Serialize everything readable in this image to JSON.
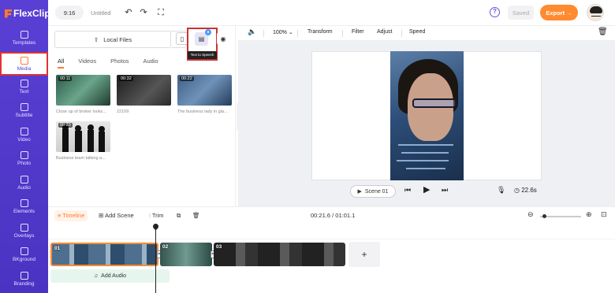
{
  "app": {
    "brand": "FlexClip",
    "project_title": "Untitled"
  },
  "topbar": {
    "ratio": "9:16",
    "saved_label": "Saved",
    "export_label": "Export →"
  },
  "sidebar": {
    "items": [
      {
        "label": "Templates"
      },
      {
        "label": "Media"
      },
      {
        "label": "Text"
      },
      {
        "label": "Subtitle"
      },
      {
        "label": "Video"
      },
      {
        "label": "Photo"
      },
      {
        "label": "Audio"
      },
      {
        "label": "Elements"
      },
      {
        "label": "Overlays"
      },
      {
        "label": "BKground"
      },
      {
        "label": "Branding"
      }
    ]
  },
  "media": {
    "local_files_label": "Local Files",
    "tooltip": "Text to Speech",
    "tabs": [
      "All",
      "Videos",
      "Photos",
      "Audio"
    ],
    "items": [
      {
        "duration": "00:11",
        "caption": "Close up of broker looks..."
      },
      {
        "duration": "00:32",
        "caption": "22109"
      },
      {
        "duration": "00:22",
        "caption": "The business lady in gla..."
      },
      {
        "duration": "00:23",
        "caption": "Business team talking a..."
      }
    ]
  },
  "preview_toolbar": {
    "zoom": "100%",
    "transform": "Transform",
    "filter": "Filter",
    "adjust": "Adjust",
    "speed": "Speed"
  },
  "player": {
    "scene_label": "Scene 01",
    "duration": "22.6s"
  },
  "timeline": {
    "timeline_label": "Timeline",
    "add_scene_label": "Add Scene",
    "trim_label": "Trim",
    "time": "00:21.6 / 01:01.1",
    "clips": [
      {
        "num": "01"
      },
      {
        "num": "02"
      },
      {
        "num": "03"
      }
    ],
    "add_audio_label": "Add Audio"
  },
  "colors": {
    "accent": "#ff8a2f",
    "sidebar": "#5a3fd4",
    "highlight_frame": "#cc3333"
  }
}
